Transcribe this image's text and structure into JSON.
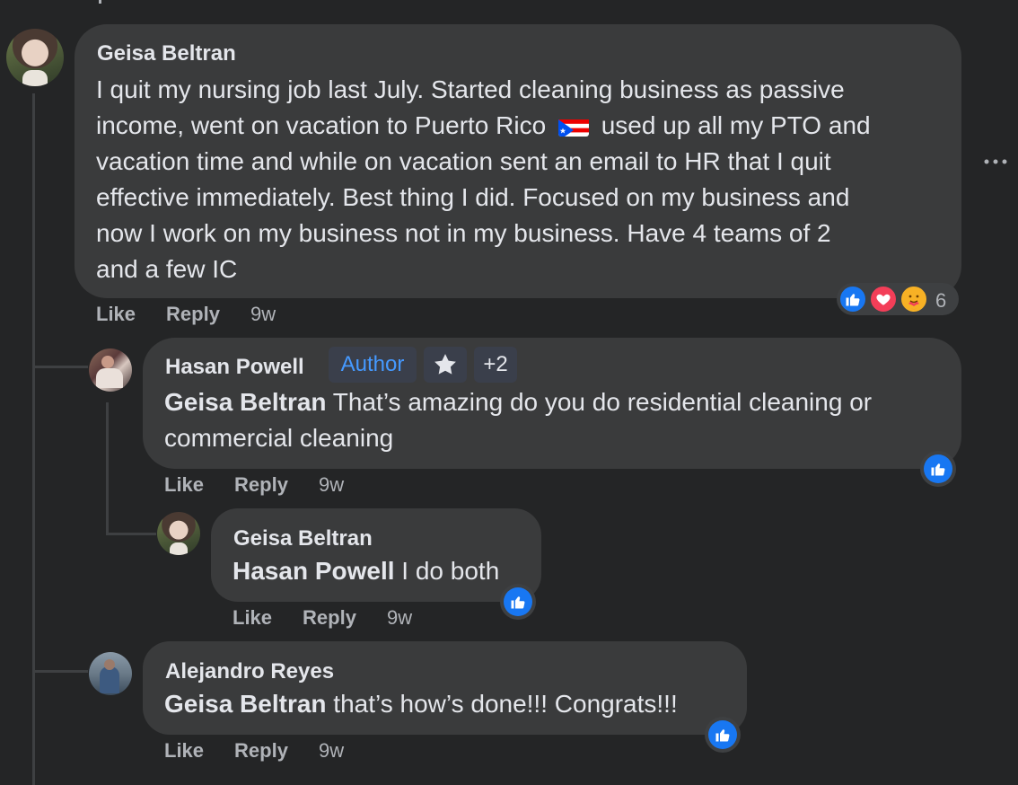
{
  "comments": [
    {
      "author": "Geisa Beltran",
      "lines": [
        "I quit my nursing job last July. Started cleaning business as passive",
        "income, went on vacation to Puerto Rico",
        "used up all my PTO and",
        "vacation time and while on vacation sent an email to HR that I quit",
        "effective immediately. Best thing I did. Focused on my business and",
        "now I work on my business not in my business. Have 4 teams of 2",
        "and a few IC"
      ],
      "flag_emoji": "puerto-rico-flag",
      "reaction_count": "6",
      "actions": {
        "like": "Like",
        "reply": "Reply",
        "time": "9w"
      }
    },
    {
      "author": "Hasan Powell",
      "badges": {
        "author": "Author",
        "more": "+2"
      },
      "mention": "Geisa Beltran",
      "text_line1": " That’s amazing do you do residential cleaning or",
      "text_line2": "commercial cleaning",
      "actions": {
        "like": "Like",
        "reply": "Reply",
        "time": "9w"
      }
    },
    {
      "author": "Geisa Beltran",
      "mention": "Hasan Powell",
      "text": " I do both",
      "actions": {
        "like": "Like",
        "reply": "Reply",
        "time": "9w"
      }
    },
    {
      "author": "Alejandro Reyes",
      "mention": "Geisa Beltran",
      "text": " that’s how’s done!!! Congrats!!!",
      "actions": {
        "like": "Like",
        "reply": "Reply",
        "time": "9w"
      }
    }
  ],
  "icons": {
    "more": "more-options-icon",
    "like": "like-reaction-icon",
    "love": "love-reaction-icon",
    "care": "care-reaction-icon",
    "star": "star-icon"
  },
  "colors": {
    "background": "#242526",
    "bubble": "#3a3b3c",
    "text": "#e4e6eb",
    "secondary": "#b0b3b8",
    "author_badge": "#4599ff",
    "like_blue": "#1877f2",
    "love_red": "#f33e58",
    "care_yellow": "#f7b125"
  }
}
